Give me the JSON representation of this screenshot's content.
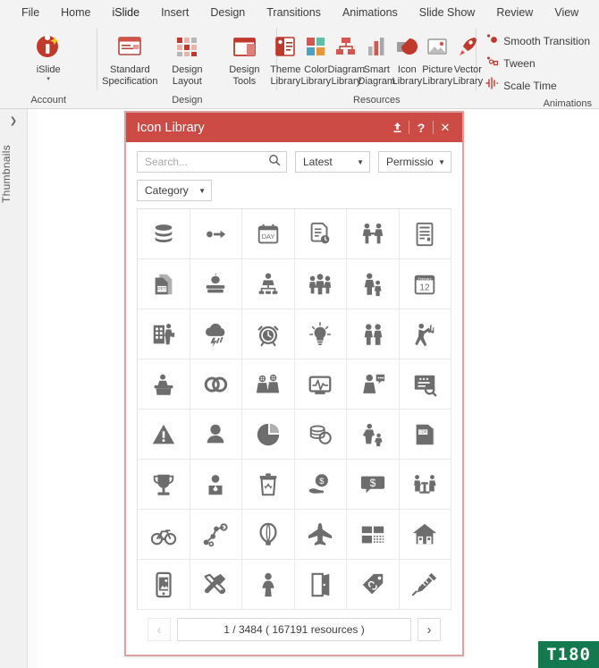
{
  "menubar": {
    "items": [
      {
        "label": "File",
        "active": false
      },
      {
        "label": "Home",
        "active": false
      },
      {
        "label": "iSlide",
        "active": true
      },
      {
        "label": "Insert",
        "active": false
      },
      {
        "label": "Design",
        "active": false
      },
      {
        "label": "Transitions",
        "active": false
      },
      {
        "label": "Animations",
        "active": false
      },
      {
        "label": "Slide Show",
        "active": false
      },
      {
        "label": "Review",
        "active": false
      },
      {
        "label": "View",
        "active": false
      }
    ]
  },
  "ribbon": {
    "groups": [
      {
        "name": "account",
        "label": "Account",
        "buttons": [
          {
            "label": "iSlide",
            "icon": "islide-logo-icon",
            "caret": true
          }
        ]
      },
      {
        "name": "design",
        "label": "Design",
        "buttons": [
          {
            "label": "Standard\nSpecification",
            "icon": "standard-specification-icon",
            "caret": true
          },
          {
            "label": "Design\nLayout",
            "icon": "design-layout-icon",
            "caret": true
          },
          {
            "label": "Design\nTools",
            "icon": "design-tools-icon",
            "caret": false
          }
        ]
      },
      {
        "name": "resources",
        "label": "Resources",
        "buttons": [
          {
            "label": "Theme\nLibrary",
            "icon": "theme-library-icon",
            "caret": false
          },
          {
            "label": "Color\nLibrary",
            "icon": "color-library-icon",
            "caret": false
          },
          {
            "label": "Diagram\nLibrary",
            "icon": "diagram-library-icon",
            "caret": false
          },
          {
            "label": "Smart\nDiagram",
            "icon": "smart-diagram-icon",
            "caret": false
          },
          {
            "label": "Icon\nLibrary",
            "icon": "icon-library-icon",
            "caret": false
          },
          {
            "label": "Picture\nLibrary",
            "icon": "picture-library-icon",
            "caret": false
          },
          {
            "label": "Vector\nLibrary",
            "icon": "vector-library-icon",
            "caret": false
          }
        ]
      },
      {
        "name": "animations",
        "label": "Animations",
        "commands": [
          {
            "label": "Smooth Transition",
            "icon": "smooth-transition-icon"
          },
          {
            "label": "Tween",
            "icon": "tween-icon"
          },
          {
            "label": "Scale Time",
            "icon": "scale-time-icon"
          }
        ]
      }
    ]
  },
  "sidebar": {
    "label": "Thumbnails",
    "chevron": "❯"
  },
  "panel": {
    "title": "Icon Library",
    "title_buttons": [
      {
        "name": "upload-icon",
        "glyph": "⬆"
      },
      {
        "name": "help-icon",
        "glyph": "?"
      },
      {
        "name": "close-icon",
        "glyph": "✕"
      }
    ],
    "search": {
      "placeholder": "Search...",
      "value": "",
      "icon": "search-icon"
    },
    "sort_dropdown": {
      "value": "Latest",
      "arrow": "▼"
    },
    "permission_dropdown": {
      "value": "Permission",
      "arrow": "▼"
    },
    "category_dropdown": {
      "value": "Category",
      "arrow": "▼"
    },
    "grid": {
      "columns": 6,
      "rows": 8,
      "icons": [
        {
          "name": "database-layers-icon",
          "label": "Database"
        },
        {
          "name": "dot-arrow-right-icon",
          "label": "Move Right"
        },
        {
          "name": "day-calendar-icon",
          "label": "Day Calendar"
        },
        {
          "name": "document-clock-icon",
          "label": "Document History"
        },
        {
          "name": "handshake-people-icon",
          "label": "Partnership"
        },
        {
          "name": "document-lines-icon",
          "label": "Document"
        },
        {
          "name": "ppt-file-icon",
          "label": "PPT File"
        },
        {
          "name": "apple-books-icon",
          "label": "Education"
        },
        {
          "name": "org-chart-person-icon",
          "label": "Organization"
        },
        {
          "name": "family-group-icon",
          "label": "Family Group"
        },
        {
          "name": "mother-child-icon",
          "label": "Mother and Child"
        },
        {
          "name": "february-12-calendar-icon",
          "label": "Calendar Date"
        },
        {
          "name": "building-person-icon",
          "label": "Office Worker"
        },
        {
          "name": "storm-cloud-icon",
          "label": "Thunderstorm"
        },
        {
          "name": "alarm-clock-icon",
          "label": "Alarm Clock"
        },
        {
          "name": "lightbulb-idea-icon",
          "label": "Idea"
        },
        {
          "name": "two-people-icon",
          "label": "Couple"
        },
        {
          "name": "person-music-icon",
          "label": "Music Performer"
        },
        {
          "name": "person-desk-icon",
          "label": "Reception Desk"
        },
        {
          "name": "interlocking-rings-icon",
          "label": "Rings"
        },
        {
          "name": "people-globes-icon",
          "label": "Global Team"
        },
        {
          "name": "monitor-heartbeat-icon",
          "label": "Monitoring"
        },
        {
          "name": "person-speech-bubble-icon",
          "label": "Consultation"
        },
        {
          "name": "document-search-icon",
          "label": "Document Search"
        },
        {
          "name": "warning-triangle-icon",
          "label": "Warning"
        },
        {
          "name": "user-avatar-icon",
          "label": "User"
        },
        {
          "name": "pie-chart-icon",
          "label": "Pie Chart"
        },
        {
          "name": "coins-stack-icon",
          "label": "Coins"
        },
        {
          "name": "person-teaching-child-icon",
          "label": "Teaching"
        },
        {
          "name": "cdr-file-icon",
          "label": "CDR File"
        },
        {
          "name": "trophy-icon",
          "label": "Trophy"
        },
        {
          "name": "person-portrait-icon",
          "label": "Portrait"
        },
        {
          "name": "recycle-bin-icon",
          "label": "Recycle Bin"
        },
        {
          "name": "hand-money-icon",
          "label": "Money in Hand"
        },
        {
          "name": "dollar-speech-bubble-icon",
          "label": "Price Talk"
        },
        {
          "name": "people-table-icon",
          "label": "Meeting"
        },
        {
          "name": "bicycle-icon",
          "label": "Bicycle"
        },
        {
          "name": "network-nodes-icon",
          "label": "Network"
        },
        {
          "name": "hot-air-balloon-icon",
          "label": "Hot Air Balloon"
        },
        {
          "name": "airplane-icon",
          "label": "Airplane"
        },
        {
          "name": "grid-layout-icon",
          "label": "Layout Grid"
        },
        {
          "name": "house-icon",
          "label": "House"
        },
        {
          "name": "smartphone-photo-icon",
          "label": "Mobile Photo"
        },
        {
          "name": "tools-wrench-hammer-icon",
          "label": "Tools"
        },
        {
          "name": "female-figure-icon",
          "label": "Female"
        },
        {
          "name": "open-door-icon",
          "label": "Open Door"
        },
        {
          "name": "price-tags-icon",
          "label": "Tags"
        },
        {
          "name": "syringe-icon",
          "label": "Syringe"
        }
      ]
    },
    "pagination": {
      "prev_glyph": "‹",
      "next_glyph": "›",
      "info": "1 / 3484 ( 167191 resources )",
      "prev_disabled": true
    }
  },
  "watermark": {
    "text": "T180"
  },
  "colors": {
    "accent": "#cc4b45",
    "panel_border": "#dba2a0",
    "ribbon_bg": "#f3f3f3",
    "icon_gray": "#6b6b6b",
    "watermark_bg": "#15794f"
  }
}
